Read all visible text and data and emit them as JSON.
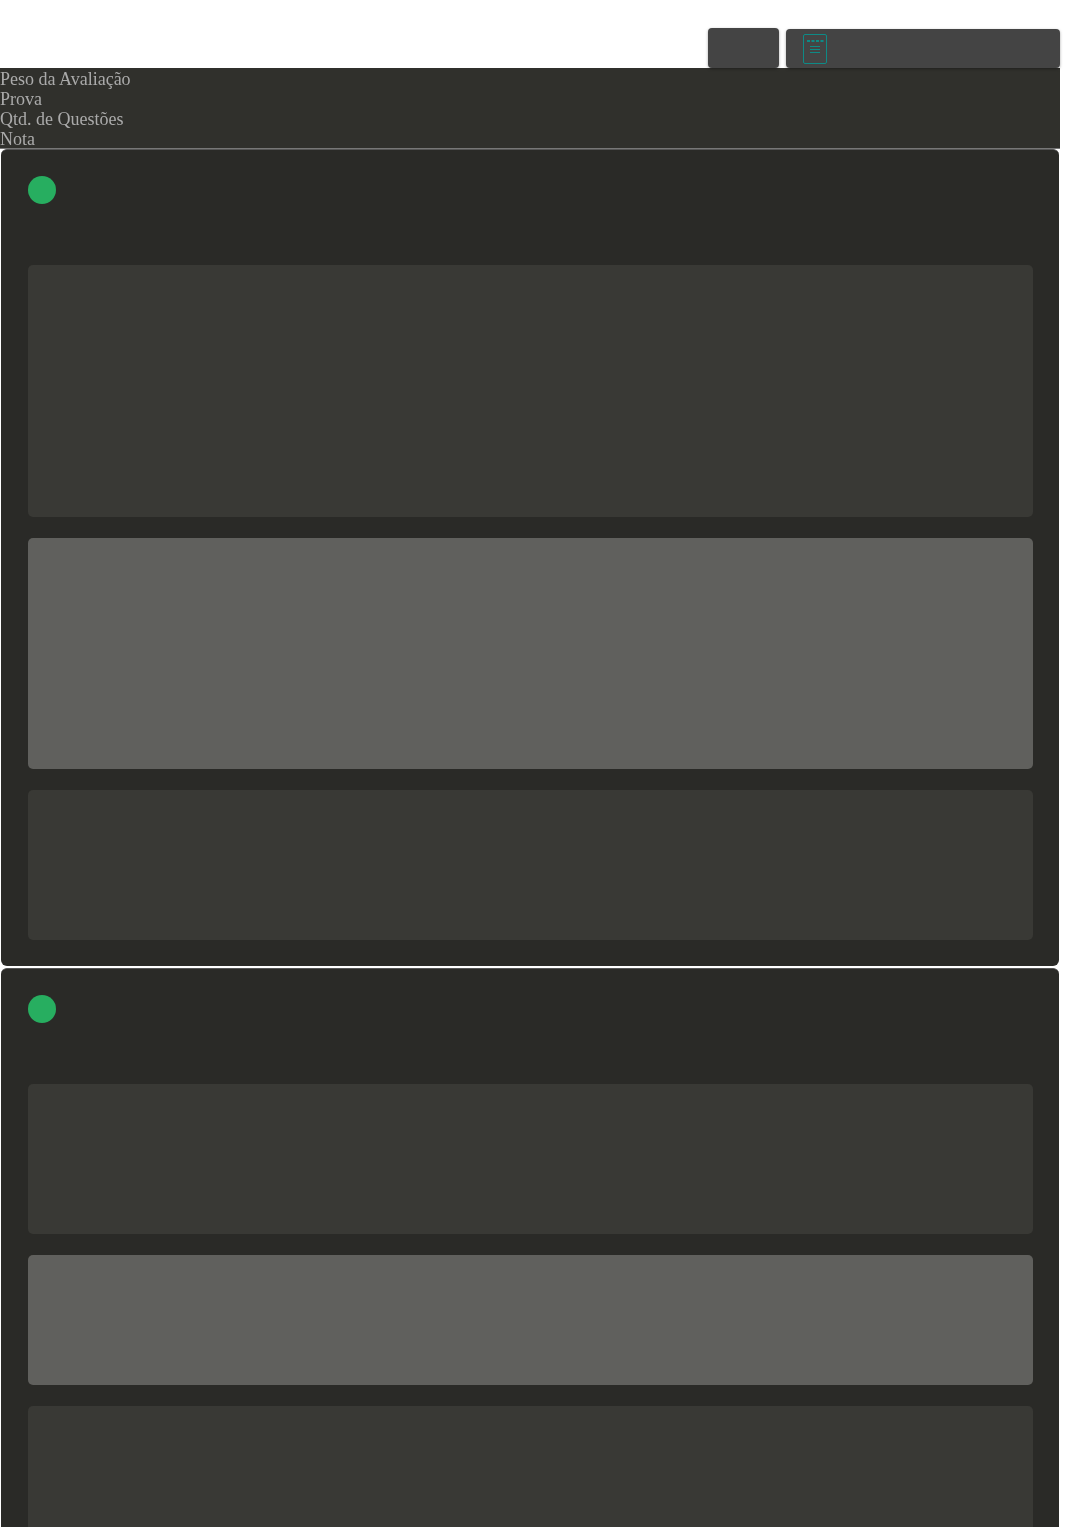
{
  "toolbar": {
    "buttons": [
      {
        "kind": "blank"
      },
      {
        "kind": "document"
      }
    ]
  },
  "header": {
    "labels": [
      "Peso da Avaliação",
      "Prova",
      "Qtd. de Questões",
      "Nota"
    ]
  },
  "cards": [
    {
      "color": "#27ae60",
      "expanded": true,
      "blocks": [
        {
          "kind": "panel"
        },
        {
          "kind": "highlight"
        },
        {
          "kind": "panel"
        }
      ]
    },
    {
      "color": "#27ae60",
      "expanded": false,
      "blocks": [
        {
          "kind": "panel"
        },
        {
          "kind": "highlight"
        },
        {
          "kind": "panel"
        }
      ]
    }
  ]
}
